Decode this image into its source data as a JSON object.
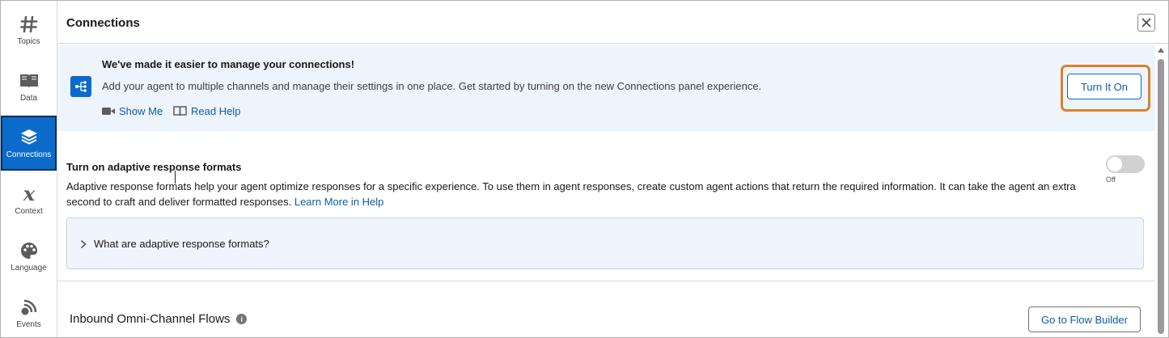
{
  "sidebar": {
    "items": [
      {
        "label": "Topics",
        "icon": "hash-icon"
      },
      {
        "label": "Data",
        "icon": "book-icon"
      },
      {
        "label": "Connections",
        "icon": "layers-icon",
        "active": true
      },
      {
        "label": "Context",
        "icon": "variable-x-icon"
      },
      {
        "label": "Language",
        "icon": "palette-icon"
      },
      {
        "label": "Events",
        "icon": "signal-icon"
      }
    ]
  },
  "header": {
    "title": "Connections"
  },
  "banner": {
    "title": "We've made it easier to manage your connections!",
    "text": "Add your agent to multiple channels and manage their settings in one place. Get started by turning on the new Connections panel experience.",
    "show_me": "Show Me",
    "read_help": "Read Help",
    "turn_on_label": "Turn It On"
  },
  "adaptive": {
    "title": "Turn on adaptive response formats",
    "text": "Adaptive response formats help your agent optimize responses for a specific experience. To use them in agent responses, create custom agent actions that return the required information. It can take the agent an extra second to craft and deliver formatted responses.",
    "learn_more": "Learn More in Help",
    "toggle_state": "Off",
    "accordion_label": "What are adaptive response formats?"
  },
  "flows": {
    "title": "Inbound Omni-Channel Flows",
    "button_label": "Go to Flow Builder"
  },
  "colors": {
    "accent": "#0b6bcb",
    "banner_bg": "#eef4fc",
    "highlight": "#d9822b"
  }
}
